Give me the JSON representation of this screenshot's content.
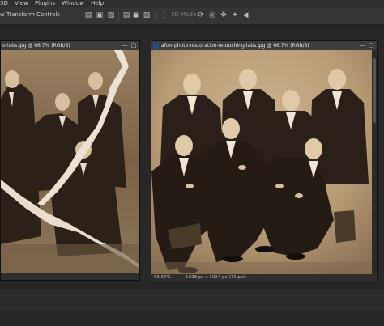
{
  "menu": [
    "3D",
    "View",
    "Plugins",
    "Window",
    "Help"
  ],
  "options": {
    "transform_label": "w Transform Controls",
    "mode_3d": "3D Mode:"
  },
  "left_doc": {
    "title": "o-labs.jpg @ 66.7% (RGB/8)",
    "zoom": "",
    "minimize": "—",
    "restore": "□"
  },
  "right_doc": {
    "title": "after-photo-restoration-retouching-labs.jpg @ 66.7% (RGB/8)",
    "zoom": "66.67%",
    "doc_info": "1028 px x 1024 px (72 ppi)",
    "minimize": "—",
    "restore": "□"
  },
  "colors": {
    "sepia_dark": "#3a2a1c",
    "sepia_light": "#c9ae86",
    "tab": "#3d3d3d"
  }
}
